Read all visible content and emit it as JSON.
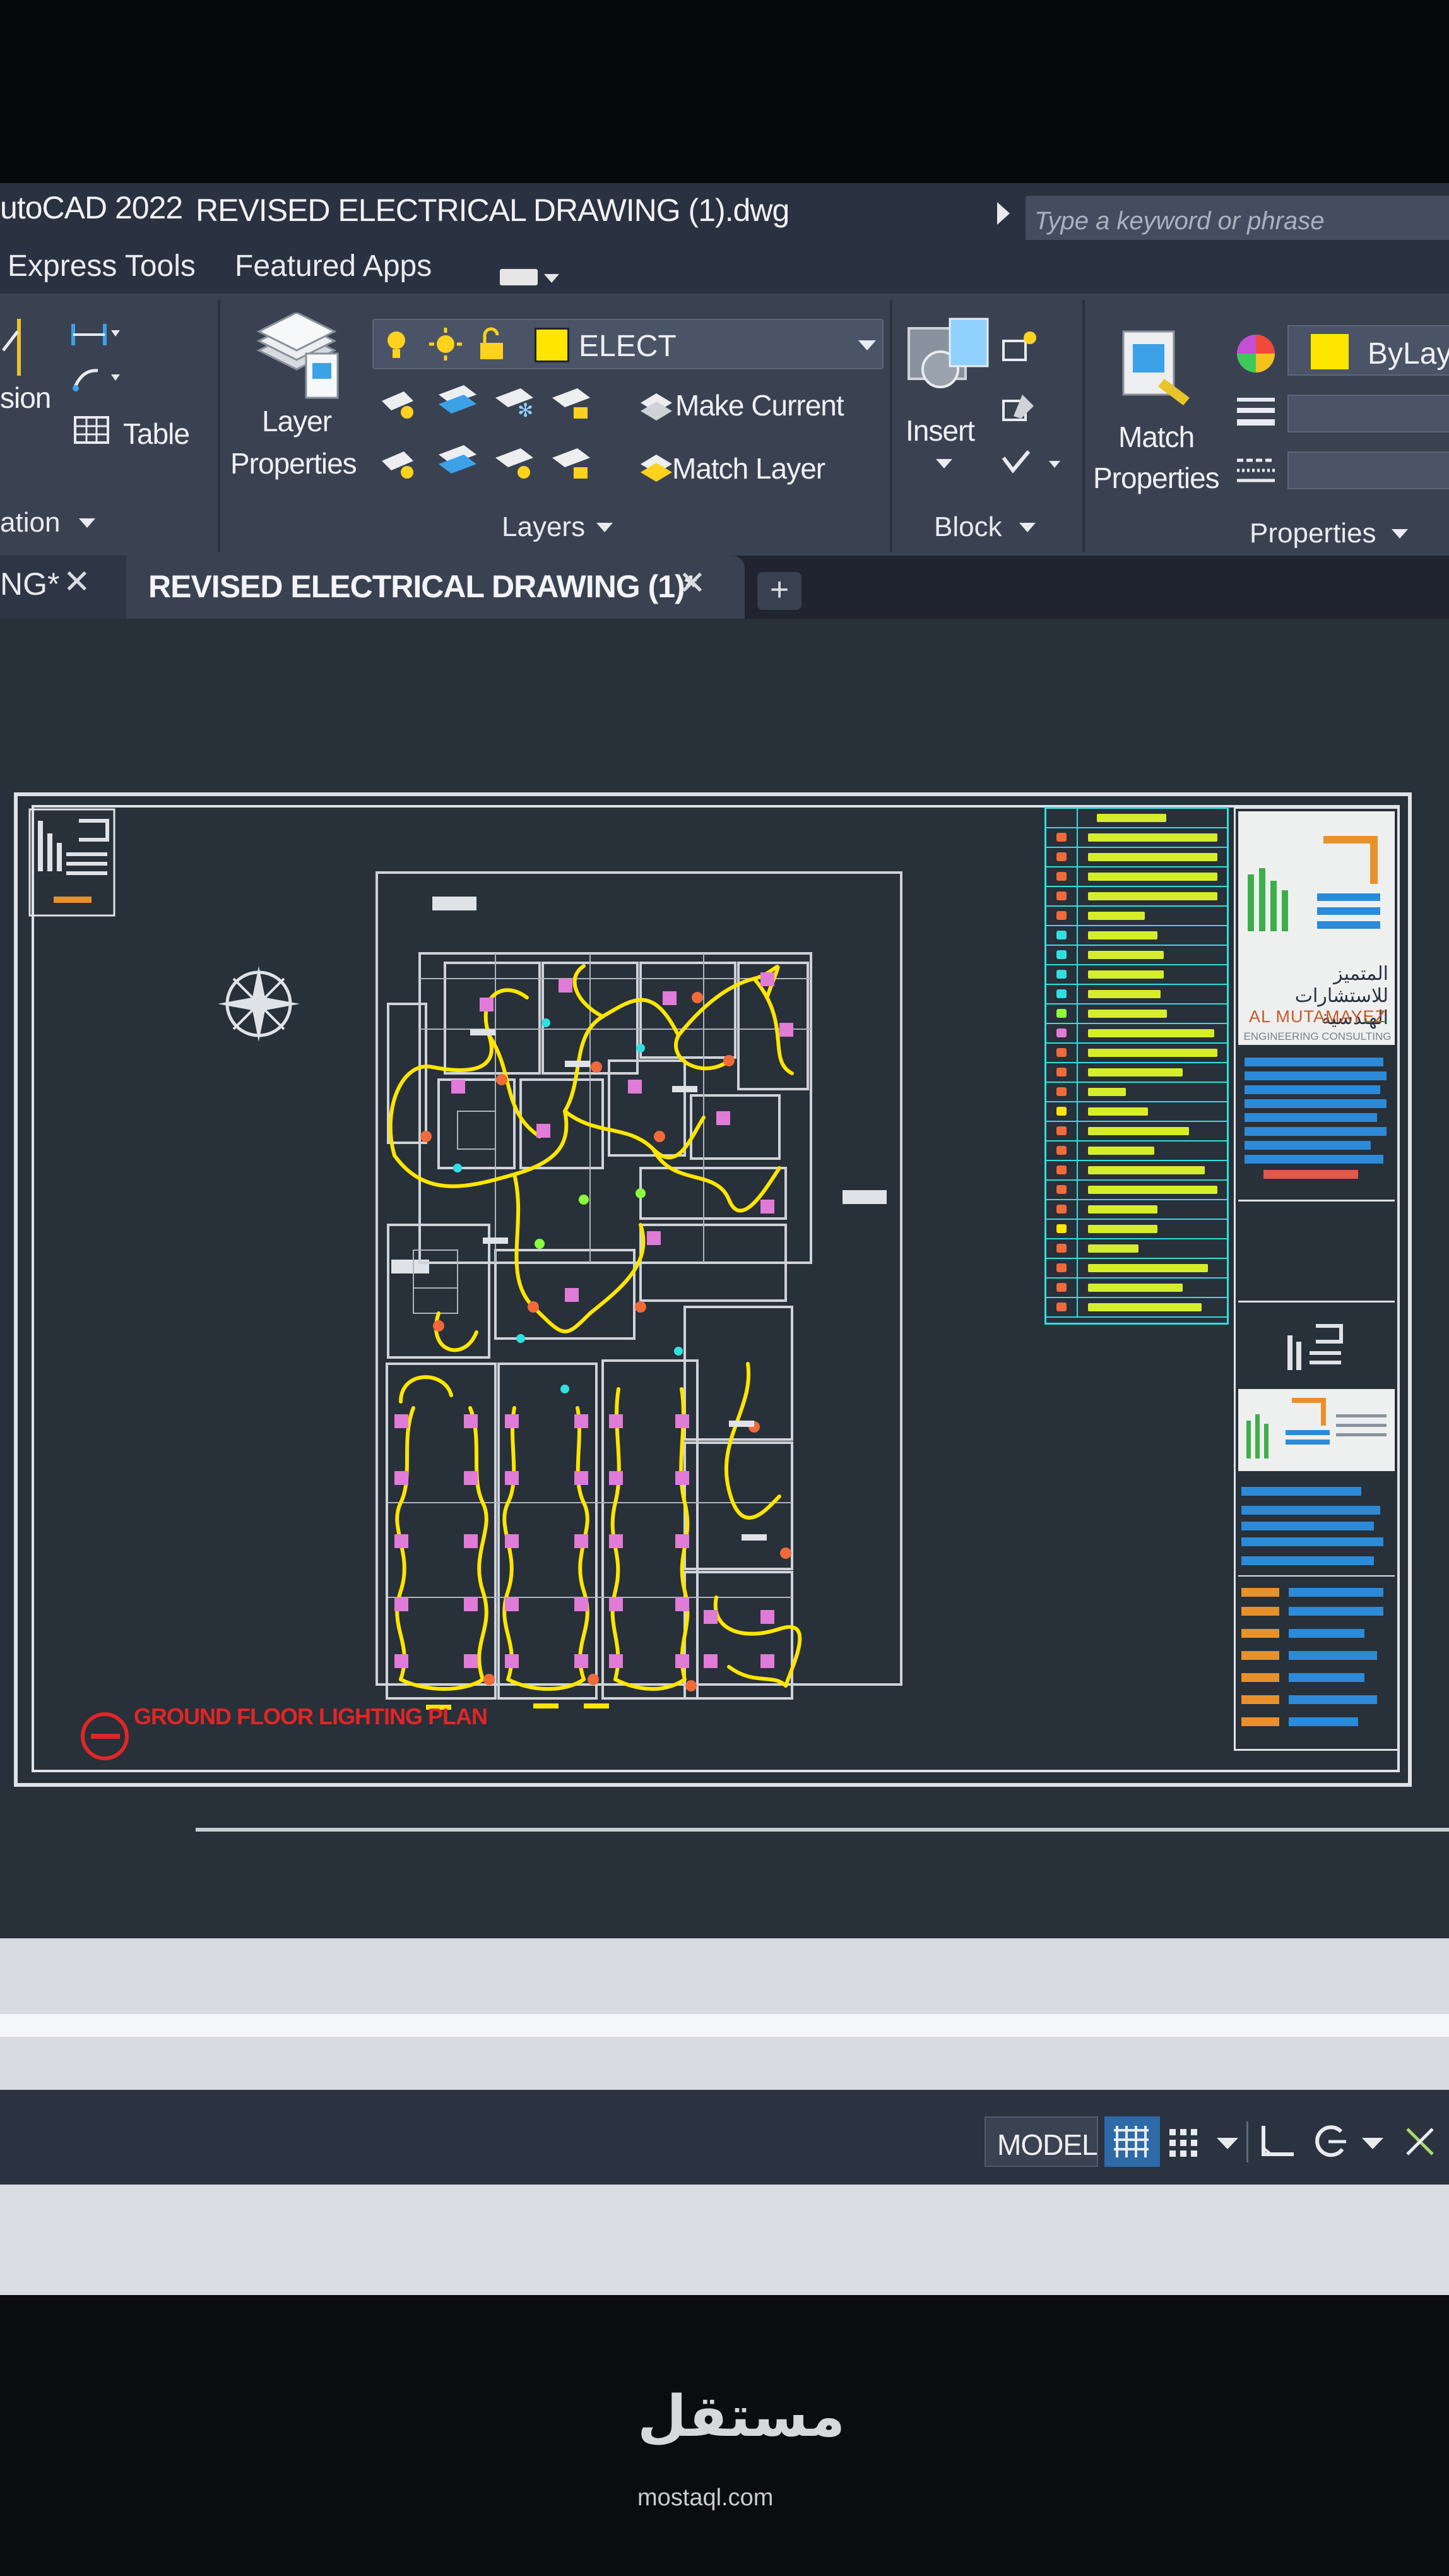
{
  "window": {
    "app_title": "utoCAD 2022",
    "document_title": "REVISED ELECTRICAL DRAWING (1).dwg",
    "search_placeholder": "Type a keyword or phrase"
  },
  "menu": {
    "items": [
      "Express Tools",
      "Featured Apps"
    ]
  },
  "ribbon": {
    "annotation_partial": {
      "dimension_label": "sion",
      "table_label": "Table",
      "panel_title": "ation"
    },
    "layers": {
      "properties_label_line1": "Layer",
      "properties_label_line2": "Properties",
      "current_layer": "ELECT",
      "current_layer_color": "#ffe600",
      "make_current_label": "Make Current",
      "match_layer_label": "Match Layer",
      "panel_title": "Layers"
    },
    "block": {
      "insert_label": "Insert",
      "panel_title": "Block"
    },
    "properties": {
      "match_properties_line1": "Match",
      "match_properties_line2": "Properties",
      "color_value": "ByLaye",
      "panel_title": "Properties"
    }
  },
  "tabs": {
    "previous_tab_label": "NG*",
    "active_tab_label": "REVISED ELECTRICAL DRAWING (1)*",
    "close_glyph": "✕",
    "add_glyph": "+"
  },
  "drawing": {
    "sheet_label": "GROUND FLOOR LIGHTING PLAN",
    "title_block": {
      "company_arabic": "المتميز للاستشارات الهندسية",
      "company_name": "AL MUTAMAYEZ",
      "company_sub": "ENGINEERING CONSULTING"
    },
    "accent_colors": {
      "wiring": "#ffe600",
      "fixtures": "#e07bd8",
      "legend_border": "#2fe0e0",
      "label": "#e02626"
    }
  },
  "status_bar": {
    "model_label": "MODEL"
  },
  "watermark": {
    "logo_text": "مستقل",
    "url_text": "mostaql.com"
  }
}
